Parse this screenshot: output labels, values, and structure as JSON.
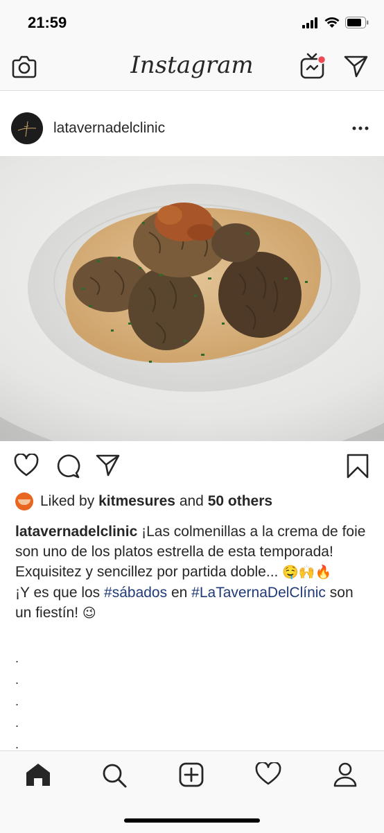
{
  "status_bar": {
    "time": "21:59"
  },
  "header": {
    "title": "Instagram"
  },
  "post": {
    "username": "latavernadelclinic",
    "likes": {
      "prefix": "Liked by",
      "user": "kitmesures",
      "middle": "and",
      "others": "50 others"
    },
    "caption": {
      "username": "latavernadelclinic",
      "text1": "¡Las colmenillas a la crema de foie son uno de los platos estrella de esta temporada! Exquisitez y sencillez por partida doble...",
      "emojis1": "🤤🙌🔥",
      "text2_a": "¡Y es que los",
      "hashtag1": "#sábados",
      "text2_b": "en",
      "hashtag2": "#LaTavernaDelClínic",
      "text2_c": "son un fiestín!",
      "emoji2": "😉",
      "dots": [
        ".",
        ".",
        ".",
        ".",
        "."
      ]
    }
  },
  "colors": {
    "accent_badge": "#ed4956",
    "hashtag": "#1f3a77",
    "text": "#262626",
    "bar_bg": "#f9f9f9"
  },
  "icons": [
    "camera-icon",
    "igtv-icon",
    "direct-icon",
    "more-icon",
    "heart-icon",
    "comment-icon",
    "share-icon",
    "bookmark-icon",
    "home-icon",
    "search-icon",
    "new-post-icon",
    "activity-icon",
    "profile-icon"
  ]
}
